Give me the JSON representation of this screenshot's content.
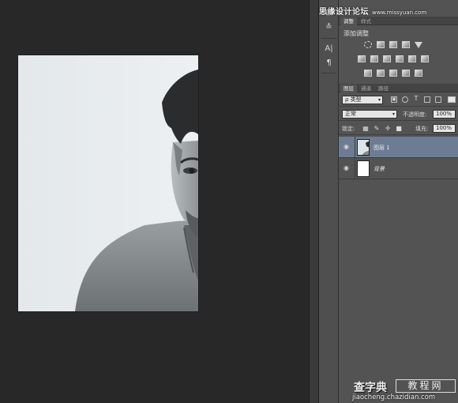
{
  "watermark_top": {
    "cn": "思缘设计论坛",
    "url": "www.missyuan.com"
  },
  "adjustments_panel": {
    "tabs": [
      {
        "label": "调整",
        "active": true
      },
      {
        "label": "样式",
        "active": false
      }
    ],
    "title": "添加调整"
  },
  "layers_panel": {
    "tabs": [
      {
        "label": "图层",
        "active": true
      },
      {
        "label": "通道",
        "active": false
      },
      {
        "label": "路径",
        "active": false
      }
    ],
    "filter_kind": "类型",
    "blend_mode": "正常",
    "opacity_label": "不透明度:",
    "opacity_value": "100%",
    "lock_label": "锁定:",
    "fill_label": "填充:",
    "fill_value": "100%",
    "layers": [
      {
        "name": "图层 1",
        "selected": true
      },
      {
        "name": "背景",
        "selected": false
      }
    ]
  },
  "watermark_bottom": {
    "brand": "查字典",
    "box": "教程网",
    "url": "jiaocheng.chazidian.com"
  },
  "colors": {
    "workspace": "#282828",
    "panel": "#535353",
    "selected_layer": "#6c7c92",
    "canvas_bg": "#e6ebee"
  }
}
